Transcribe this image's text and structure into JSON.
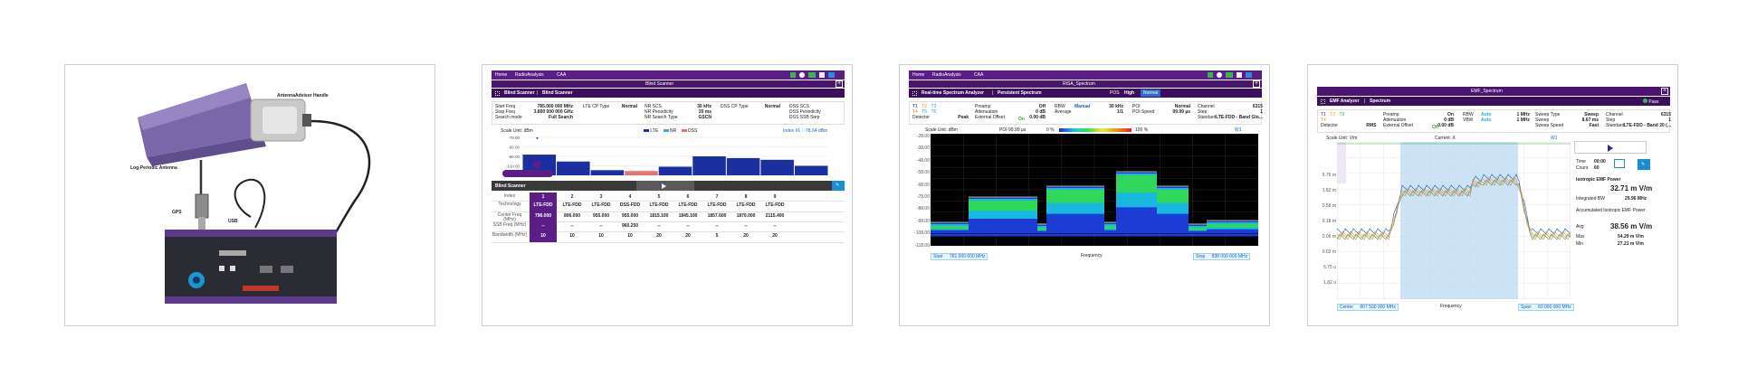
{
  "card1": {
    "antenna_label": "Log-Periodic Antenna",
    "handle_label": "AntennaAdvisor Handle",
    "gps_label": "GPS",
    "usb_label": "USB"
  },
  "nav": {
    "home": "Home",
    "radio": "RadioAnalysis",
    "caa": "CAA"
  },
  "card2": {
    "title": "Blind Scanner",
    "breadcrumb_a": "Blind Scanner",
    "breadcrumb_b": "Blind Scanner",
    "params": [
      {
        "label": "Start Freq",
        "value": "785.000 000 MHz"
      },
      {
        "label": "Stop Freq",
        "value": "3.800 000 000 GHz"
      },
      {
        "label": "Search mode",
        "value": "Full Search"
      }
    ],
    "params2": [
      {
        "label": "LTE CP Type",
        "value": "Normal"
      }
    ],
    "params3": [
      {
        "label": "NR SCS",
        "value": "30 kHz"
      },
      {
        "label": "NR Periodicity",
        "value": "20 ms"
      },
      {
        "label": "NR Search Type",
        "value": "GSCN"
      }
    ],
    "params4": [
      {
        "label": "DSS CP Type",
        "value": "Normal"
      }
    ],
    "params5": [
      {
        "label": "DSS SCS",
        "value": ""
      },
      {
        "label": "DSS Periodicity",
        "value": ""
      },
      {
        "label": "DSS SSB Step",
        "value": ""
      }
    ],
    "scale_unit": "Scale Unit: dBm",
    "legend": [
      "LTE",
      "NR",
      "DSS"
    ],
    "index_note": "Index #1 : -78.64 dBm",
    "y_ticks": [
      "-78.00",
      "-86.00",
      "-96.00",
      "-110.00",
      "-118.00"
    ],
    "panel_title": "Blind Scanner",
    "table_headers": [
      "Index",
      "Technology",
      "Center Freq (MHz)",
      "SSB Freq (MHz)",
      "Bandwidth (MHz)"
    ],
    "columns": [
      {
        "index": "1",
        "tech": "LTE-FDD",
        "center": "796.000",
        "ssb": "--",
        "bw": "10"
      },
      {
        "index": "2",
        "tech": "LTE-FDD",
        "center": "806.000",
        "ssb": "--",
        "bw": "10"
      },
      {
        "index": "3",
        "tech": "LTE-FDD",
        "center": "955.000",
        "ssb": "--",
        "bw": "10"
      },
      {
        "index": "4",
        "tech": "DSS-FDD",
        "center": "955.000",
        "ssb": "960.250",
        "bw": "10"
      },
      {
        "index": "5",
        "tech": "LTE-FDD",
        "center": "1815.100",
        "ssb": "--",
        "bw": "20"
      },
      {
        "index": "6",
        "tech": "LTE-FDD",
        "center": "1845.100",
        "ssb": "--",
        "bw": "20"
      },
      {
        "index": "7",
        "tech": "LTE-FDD",
        "center": "1857.600",
        "ssb": "--",
        "bw": "5"
      },
      {
        "index": "8",
        "tech": "LTE-FDD",
        "center": "1870.000",
        "ssb": "--",
        "bw": "20"
      },
      {
        "index": "9",
        "tech": "LTE-FDD",
        "center": "2115.400",
        "ssb": "--",
        "bw": "20"
      }
    ]
  },
  "card3": {
    "title": "RtSA_Spectrum",
    "breadcrumb_a": "Real-time Spectrum Analyzer",
    "breadcrumb_b": "Persistent Spectrum",
    "pos_label": "POS",
    "pos_val": "High",
    "normal_btn": "Normal",
    "traces": [
      "T1",
      "T2",
      "T3",
      "T4",
      "T5",
      "T6"
    ],
    "detector_label": "Detector",
    "detector_val": "Peak",
    "p1": [
      {
        "label": "Preamp",
        "value": "Off"
      },
      {
        "label": "Attenuation",
        "value": "0 dB"
      },
      {
        "label": "External Offset",
        "value": "0.00 dB"
      }
    ],
    "ext_on": "On",
    "p2": [
      {
        "label": "RBW",
        "value": "30 kHz"
      },
      {
        "label": "Average",
        "value": "1/1"
      }
    ],
    "rbw_mode": "Manual",
    "p3": [
      {
        "label": "POI",
        "value": "Normal"
      },
      {
        "label": "POI Speed",
        "value": "99.99 µs"
      }
    ],
    "p4": [
      {
        "label": "Channel",
        "value": "6315"
      },
      {
        "label": "Step",
        "value": "1"
      },
      {
        "label": "Standard",
        "value": "LTE-FDD - Band Glo..."
      }
    ],
    "scale_unit": "Scale Unit: dBm",
    "poi_note": "POI 99.99 µs",
    "pct0": "0 %",
    "pct100": "100 %",
    "w1": "W1",
    "y_ticks": [
      "-28.00",
      "-38.00",
      "-48.00",
      "-58.00",
      "-68.00",
      "-78.00",
      "-88.00",
      "-98.00",
      "-108.00",
      "-118.00"
    ],
    "start_label": "Start",
    "start_val": "761 000 000 MHz",
    "xlabel": "Frequency",
    "stop_label": "Stop",
    "stop_val": "838 000 000 MHz"
  },
  "card4": {
    "title": "EMF_Spectrum",
    "breadcrumb_a": "EMF Analyzer",
    "breadcrumb_b": "Spectrum",
    "pass": "Pass",
    "traces": [
      "T1",
      "T2",
      "T3",
      "T4"
    ],
    "detector_label": "Detector",
    "detector_val": "RMS",
    "p1": [
      {
        "label": "Preamp",
        "value": "On"
      },
      {
        "label": "Attenuation",
        "value": "0 dB"
      },
      {
        "label": "External Offset",
        "value": "0.00 dB"
      }
    ],
    "ext_off": "Off",
    "p2": [
      {
        "label": "RBW",
        "value": "1 MHz"
      },
      {
        "label": "VBW",
        "value": "1 MHz"
      }
    ],
    "auto": "Auto",
    "p3": [
      {
        "label": "Sweep Type",
        "value": "Sweep"
      },
      {
        "label": "Sweep",
        "value": "8.67 ms"
      },
      {
        "label": "Sweep Speed",
        "value": "Fast"
      }
    ],
    "p4": [
      {
        "label": "Channel",
        "value": "6315"
      },
      {
        "label": "Step",
        "value": "1"
      },
      {
        "label": "Standard",
        "value": "LTE-FDD - Band 20 (..."
      }
    ],
    "scale_unit": "Scale Unit: V/m",
    "current_x": "Current: X",
    "w1": "W1",
    "y_ticks": [
      "",
      "",
      "5.76 m",
      "1.82 m",
      "0.58 m",
      "0.18 m",
      "0.06 m",
      "0.02 m",
      "5.75 u",
      "1.82 u"
    ],
    "center_label": "Center",
    "center_val": "807 500 000 MHz",
    "xlabel": "Frequency",
    "span_label": "Span",
    "span_val": "60 000 000 MHz",
    "side": {
      "time_label": "Time",
      "time_val": "00:00",
      "count_label": "Count",
      "count_val": "60",
      "iso_label": "Isotropic EMF Power",
      "iso_val": "32.71 m V/m",
      "ibw_label": "Integrated BW",
      "ibw_val": "29.96 MHz",
      "acc_label": "Accumulated Isotropic EMF Power",
      "avg_label": "Avg",
      "avg_val": "38.56 m V/m",
      "max_label": "Max",
      "max_val": "54.29 m V/m",
      "min_label": "Min",
      "min_val": "27.21 m V/m"
    }
  },
  "chart2": {
    "type": "bar",
    "categories": [
      "1",
      "2",
      "3",
      "4",
      "5",
      "6",
      "7",
      "8",
      "9"
    ],
    "ylim": [
      -120,
      -76
    ],
    "series": [
      {
        "values": [
          -96,
          -104,
          -114,
          -115,
          -110,
          -98,
          -100,
          -102,
          -109
        ]
      }
    ]
  }
}
